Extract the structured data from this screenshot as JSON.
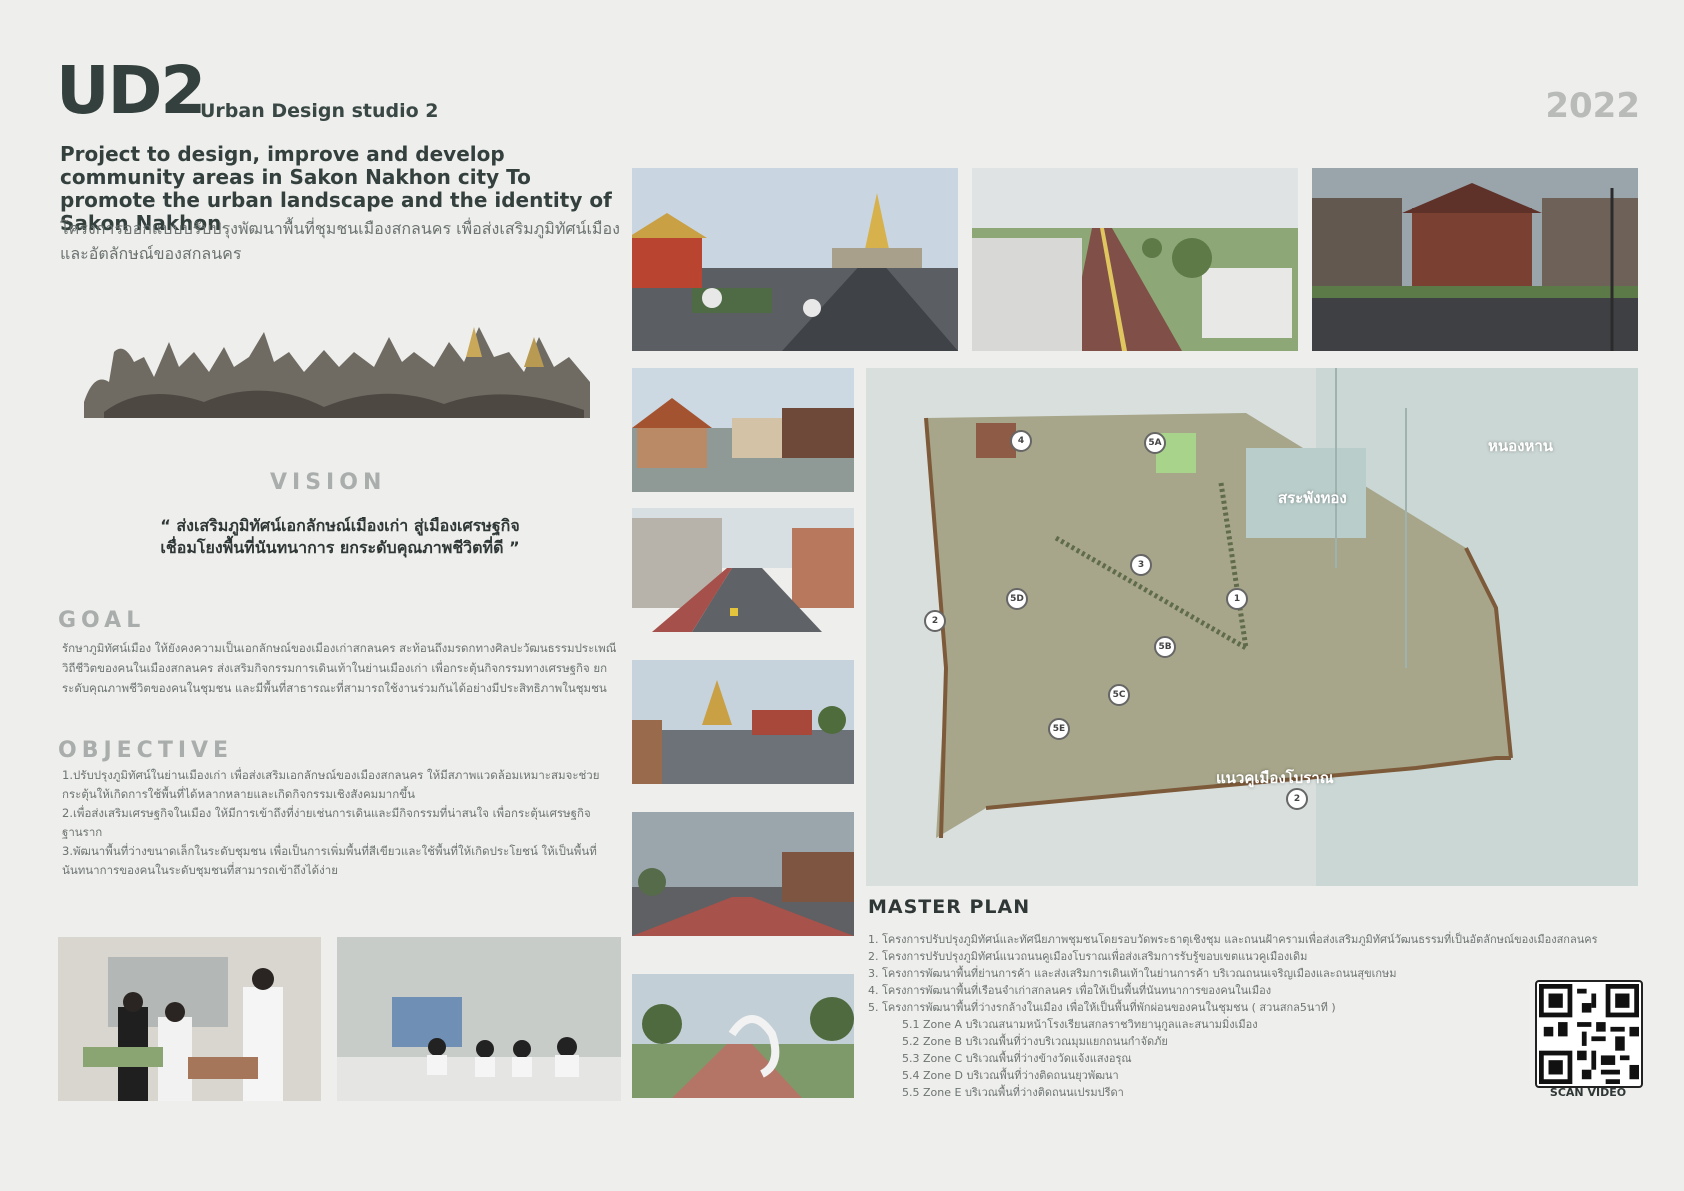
{
  "header": {
    "logo": "UD2",
    "studio": "Urban Design studio 2",
    "year": "2022"
  },
  "project": {
    "title_en": "Project to design, improve and develop community areas in Sakon Nakhon city To promote the urban landscape and the identity of Sakon Nakhon",
    "title_th": "โครงการออกแบบปรับปรุงพัฒนาพื้นที่ชุมชนเมืองสกลนคร เพื่อส่งเสริมภูมิทัศน์เมือง และอัตลักษณ์ของสกลนคร"
  },
  "vision": {
    "heading": "VISION",
    "line1": "“ ส่งเสริมภูมิทัศน์เอกลักษณ์เมืองเก่า สู่เมืองเศรษฐกิจ",
    "line2": "เชื่อมโยงพื้นที่นันทนาการ ยกระดับคุณภาพชีวิตที่ดี ”"
  },
  "goal": {
    "heading": "GOAL",
    "text": "รักษาภูมิทัศน์เมือง ให้ยังคงความเป็นเอกลักษณ์ของเมืองเก่าสกลนคร สะท้อนถึงมรดกทางศิลปะวัฒนธรรมประเพณีวิถีชีวิตของคนในเมืองสกลนคร ส่งเสริมกิจกรรมการเดินเท้าในย่านเมืองเก่า เพื่อกระตุ้นกิจกรรมทางเศรษฐกิจ ยกระดับคุณภาพชีวิตของคนในชุมชน และมีพื้นที่สาธารณะที่สามารถใช้งานร่วมกันได้อย่างมีประสิทธิภาพในชุมชน"
  },
  "objective": {
    "heading": "OBJECTIVE",
    "items": [
      "1.ปรับปรุงภูมิทัศน์ในย่านเมืองเก่า เพื่อส่งเสริมเอกลักษณ์ของเมืองสกลนคร ให้มีสภาพแวดล้อมเหมาะสมจะช่วยกระตุ้นให้เกิดการใช้พื้นที่ได้หลากหลายและเกิดกิจกรรมเชิงสังคมมากขึ้น",
      "2.เพื่อส่งเสริมเศรษฐกิจในเมือง ให้มีการเข้าถึงที่ง่ายเช่นการเดินและมีกิจกรรมที่น่าสนใจ เพื่อกระตุ้นเศรษฐกิจฐานราก",
      "3.พัฒนาพื้นที่ว่างขนาดเล็กในระดับชุมชน เพื่อเป็นการเพิ่มพื้นที่สีเขียวและใช้พื้นที่ให้เกิดประโยชน์ ให้เป็นพื้นที่นันทนาการของคนในระดับชุมชนที่สามารถเข้าถึงได้ง่าย"
    ]
  },
  "map": {
    "labels": [
      "หนองหาน",
      "สระพังทอง",
      "แนวคูเมืองโบราณ"
    ],
    "markers": [
      "4",
      "5A",
      "3",
      "1",
      "5D",
      "2",
      "5B",
      "5C",
      "5E",
      "2"
    ]
  },
  "master_plan": {
    "heading": "MASTER PLAN",
    "items": [
      "1. โครงการปรับปรุงภูมิทัศน์และทัศนียภาพชุมชนโดยรอบวัดพระธาตุเชิงชุม และถนนฝ้าครามเพื่อส่งเสริมภูมิทัศน์วัฒนธรรมที่เป็นอัตลักษณ์ของเมืองสกลนคร",
      "2. โครงการปรับปรุงภูมิทัศน์แนวถนนคูเมืองโบราณเพื่อส่งเสริมการรับรู้ขอบเขตแนวคูเมืองเดิม",
      "3. โครงการพัฒนาพื้นที่ย่านการค้า และส่งเสริมการเดินเท้าในย่านการค้า บริเวณถนนเจริญเมืองและถนนสุขเกษม",
      "4. โครงการพัฒนาพื้นที่เรือนจำเก่าสกลนคร เพื่อให้เป็นพื้นที่นันทนาการของคนในเมือง",
      "5. โครงการพัฒนาพื้นที่ว่างรกล้างในเมือง เพื่อให้เป็นพื้นที่พักผ่อนของคนในชุมชน ( สวนสกล5นาที )"
    ],
    "subitems": [
      "5.1 Zone A บริเวณสนามหน้าโรงเรียนสกลราชวิทยานุกูลและสนามมิ่งเมือง",
      "5.2 Zone B บริเวณพื้นที่ว่างบริเวณมุมแยกถนนกำจัดภัย",
      "5.3 Zone C บริเวณพื้นที่ว่างข้างวัดแจ้งแสงอรุณ",
      "5.4 Zone D บริเวณพื้นที่ว่างติดถนนยุวพัฒนา",
      "5.5 Zone E บริเวณพื้นที่ว่างติดถนนเปรมปรีดา"
    ]
  },
  "qr": {
    "caption": "SCAN VIDEO"
  }
}
